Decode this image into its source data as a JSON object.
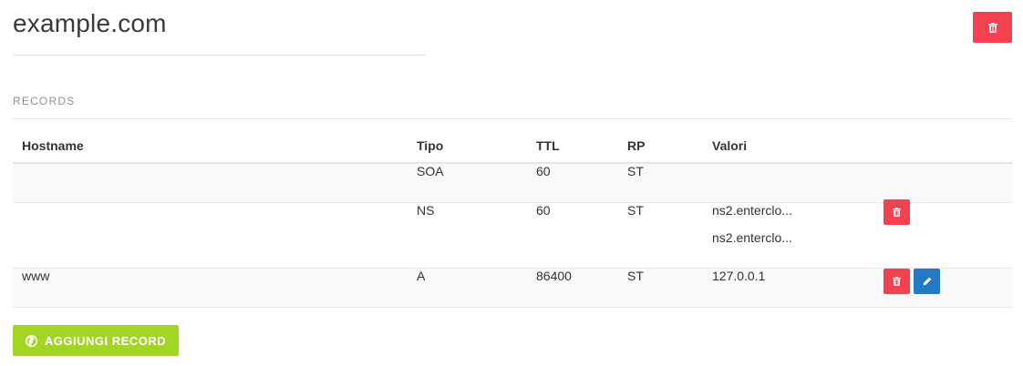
{
  "header": {
    "domain": "example.com"
  },
  "records_section": {
    "label": "RECORDS"
  },
  "table": {
    "columns": [
      "Hostname",
      "Tipo",
      "TTL",
      "RP",
      "Valori"
    ],
    "rows": [
      {
        "hostname": "",
        "type": "SOA",
        "ttl": "60",
        "rp": "ST",
        "values": []
      },
      {
        "hostname": "",
        "type": "NS",
        "ttl": "60",
        "rp": "ST",
        "values": [
          "ns2.enterclo...",
          "ns2.enterclo..."
        ]
      },
      {
        "hostname": "www",
        "type": "A",
        "ttl": "86400",
        "rp": "ST",
        "values": [
          "127.0.0.1"
        ]
      }
    ]
  },
  "actions": {
    "add_record_label": "AGGIUNGI RECORD"
  },
  "icons": {
    "delete": "trash-icon",
    "edit": "pencil-icon",
    "add": "globe-icon"
  },
  "colors": {
    "danger": "#f2414f",
    "primary": "#2479c4",
    "success": "#a3d624"
  }
}
